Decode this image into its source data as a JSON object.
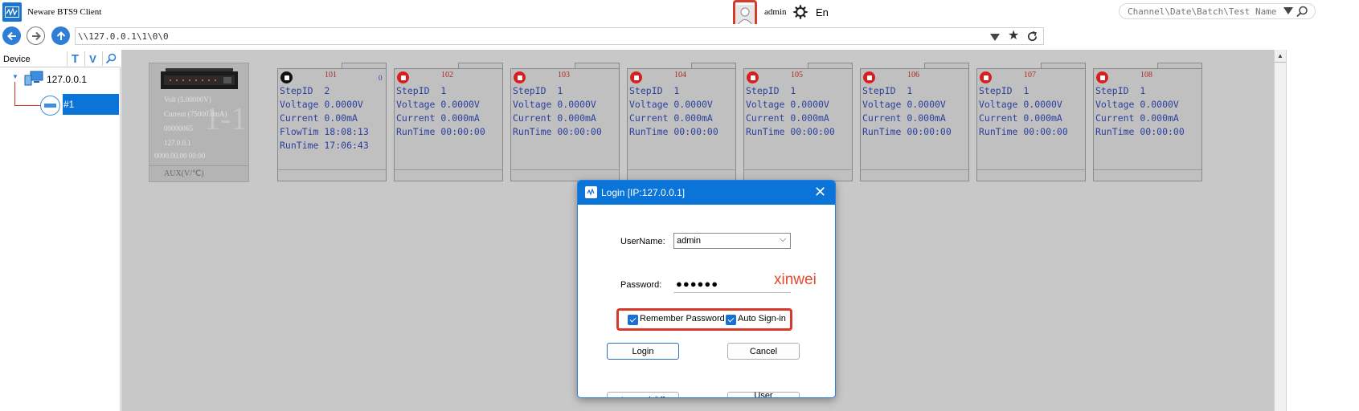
{
  "titlebar": {
    "app_title": "Neware BTS9 Client",
    "user_name": "admin",
    "language": "En",
    "search_placeholder": "Channel\\Date\\Batch\\Test Name"
  },
  "addressbar": {
    "path": "\\\\127.0.0.1\\1\\0\\0"
  },
  "device_panel": {
    "header": "Device",
    "tools": [
      "T",
      "V"
    ],
    "host": "127.0.0.1",
    "unit": "#1"
  },
  "device_tile": {
    "ghost_text": "1-1",
    "volt": "Volt (5.00000V)",
    "current": "Current (75000.0mA)",
    "serial": "00000065",
    "ip": "127.0.0.1",
    "timestamp": "0000.00.00 00:00",
    "aux": "AUX(V/℃)"
  },
  "channels": [
    {
      "num": "101",
      "corner": "0",
      "status": "black",
      "lines": [
        "StepID  2",
        "Voltage 0.0000V",
        "Current 0.00mA",
        "FlowTim 18:08:13",
        "RunTime 17:06:43"
      ]
    },
    {
      "num": "102",
      "corner": "",
      "status": "red",
      "lines": [
        "StepID  1",
        "Voltage 0.0000V",
        "Current 0.000mA",
        "RunTime 00:00:00"
      ]
    },
    {
      "num": "103",
      "corner": "",
      "status": "red",
      "lines": [
        "StepID  1",
        "Voltage 0.0000V",
        "Current 0.000mA",
        "RunTime 00:00:00"
      ]
    },
    {
      "num": "104",
      "corner": "",
      "status": "red",
      "lines": [
        "StepID  1",
        "Voltage 0.0000V",
        "Current 0.000mA",
        "RunTime 00:00:00"
      ]
    },
    {
      "num": "105",
      "corner": "",
      "status": "red",
      "lines": [
        "StepID  1",
        "Voltage 0.0000V",
        "Current 0.000mA",
        "RunTime 00:00:00"
      ]
    },
    {
      "num": "106",
      "corner": "",
      "status": "red",
      "lines": [
        "StepID  1",
        "Voltage 0.0000V",
        "Current 0.000mA",
        "RunTime 00:00:00"
      ]
    },
    {
      "num": "107",
      "corner": "",
      "status": "red",
      "lines": [
        "StepID  1",
        "Voltage 0.0000V",
        "Current 0.000mA",
        "RunTime 00:00:00"
      ]
    },
    {
      "num": "108",
      "corner": "",
      "status": "red",
      "lines": [
        "StepID  1",
        "Voltage 0.0000V",
        "Current 0.000mA",
        "RunTime 00:00:00"
      ]
    }
  ],
  "dialog": {
    "title": "Login [IP:127.0.0.1]",
    "username_label": "UserName:",
    "username_value": "admin",
    "password_label": "Password:",
    "password_mask": "●●●●●●",
    "password_hint": "xinwei",
    "remember_label": "Remember Password",
    "autosignin_label": "Auto Sign-in",
    "login_label": "Login",
    "cancel_label": "Cancel",
    "logoff_label": "Logged Off",
    "usermgmt_label": "User management"
  },
  "colors": {
    "accent": "#0a74d8",
    "highlight": "#d63a2a",
    "channel_text": "#2b3f9e",
    "stop_red": "#d62020"
  }
}
